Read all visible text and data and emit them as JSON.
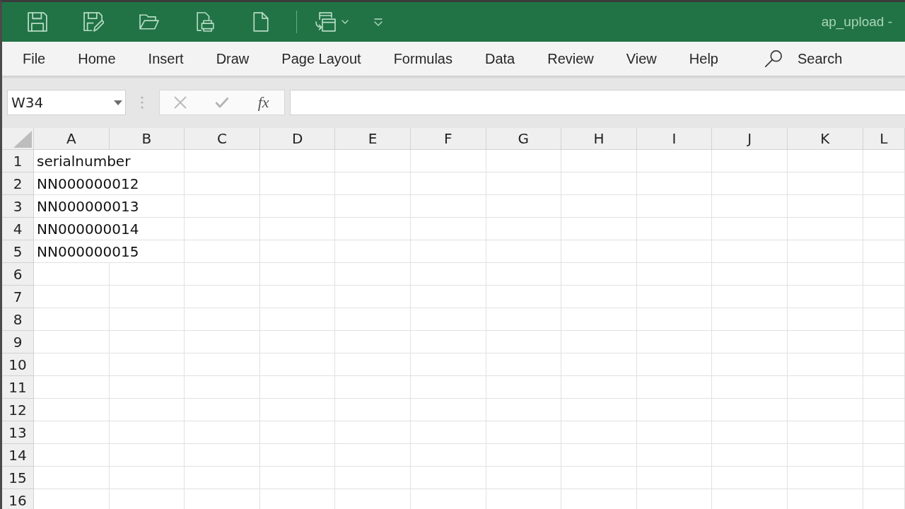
{
  "title_bar": {
    "title": "ap_upload -"
  },
  "ribbon_tabs": [
    {
      "label": "File",
      "selected": false
    },
    {
      "label": "Home",
      "selected": false
    },
    {
      "label": "Insert",
      "selected": false
    },
    {
      "label": "Draw",
      "selected": false
    },
    {
      "label": "Page Layout",
      "selected": false
    },
    {
      "label": "Formulas",
      "selected": false
    },
    {
      "label": "Data",
      "selected": false
    },
    {
      "label": "Review",
      "selected": false
    },
    {
      "label": "View",
      "selected": false
    },
    {
      "label": "Help",
      "selected": false
    }
  ],
  "search": {
    "label": "Search"
  },
  "formula_bar": {
    "name_box": "W34",
    "function_button": "fx"
  },
  "sheet": {
    "columns": [
      "A",
      "B",
      "C",
      "D",
      "E",
      "F",
      "G",
      "H",
      "I",
      "J",
      "K",
      "L"
    ],
    "rows": [
      {
        "number": "1",
        "cells": [
          "serialnumber"
        ]
      },
      {
        "number": "2",
        "cells": [
          "NN000000012"
        ]
      },
      {
        "number": "3",
        "cells": [
          "NN000000013"
        ]
      },
      {
        "number": "4",
        "cells": [
          "NN000000014"
        ]
      },
      {
        "number": "5",
        "cells": [
          "NN000000015"
        ]
      },
      {
        "number": "6"
      },
      {
        "number": "7"
      },
      {
        "number": "8"
      },
      {
        "number": "9"
      },
      {
        "number": "10"
      },
      {
        "number": "11"
      },
      {
        "number": "12"
      },
      {
        "number": "13"
      },
      {
        "number": "14"
      },
      {
        "number": "15"
      },
      {
        "number": "16"
      }
    ]
  }
}
